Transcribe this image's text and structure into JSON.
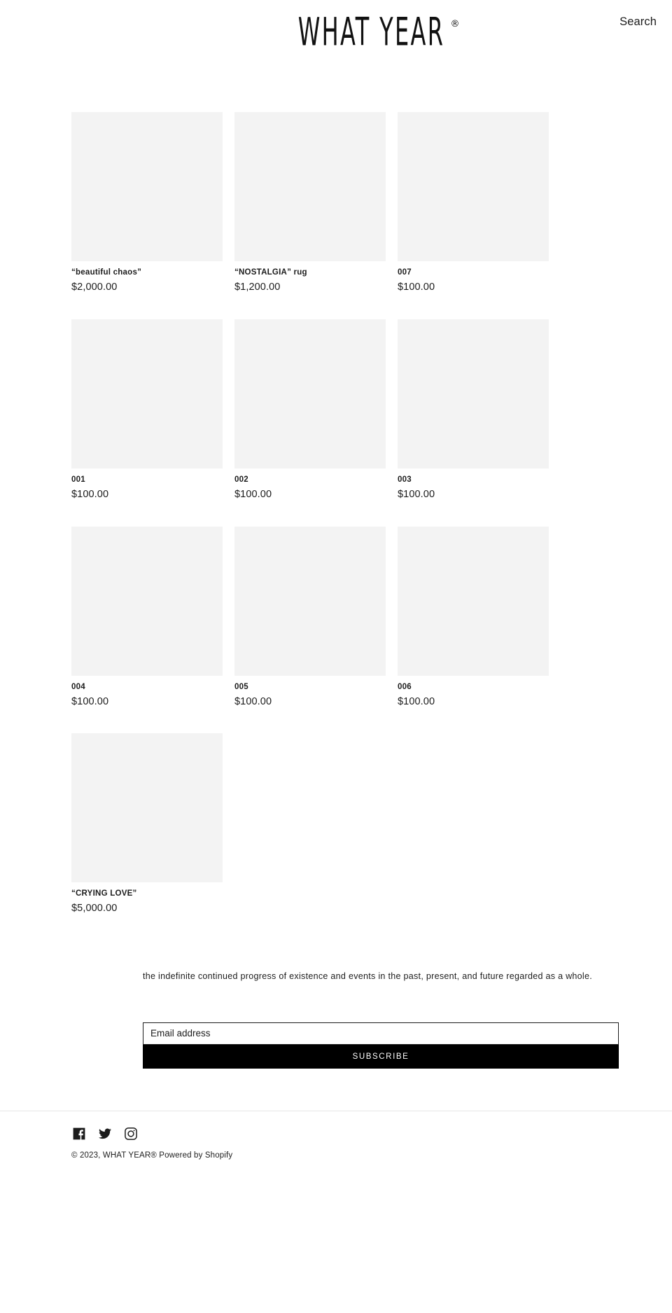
{
  "header": {
    "logo_text": "WHAT YEAR",
    "logo_registered": "®",
    "search_label": "Search"
  },
  "products": [
    {
      "title": "“beautiful chaos”",
      "price": "$2,000.00"
    },
    {
      "title": "“NOSTALGIA” rug",
      "price": "$1,200.00"
    },
    {
      "title": "007",
      "price": "$100.00"
    },
    {
      "title": "001",
      "price": "$100.00"
    },
    {
      "title": "002",
      "price": "$100.00"
    },
    {
      "title": "003",
      "price": "$100.00"
    },
    {
      "title": "004",
      "price": "$100.00"
    },
    {
      "title": "005",
      "price": "$100.00"
    },
    {
      "title": "006",
      "price": "$100.00"
    },
    {
      "title": "“CRYING LOVE”",
      "price": "$5,000.00"
    }
  ],
  "tagline": "the indefinite continued progress of existence and events in the past, present, and future regarded as a whole.",
  "newsletter": {
    "email_placeholder": "Email address",
    "email_value": "",
    "subscribe_label": "SUBSCRIBE"
  },
  "footer": {
    "social": [
      {
        "name": "facebook-icon",
        "label": "Facebook"
      },
      {
        "name": "twitter-icon",
        "label": "Twitter"
      },
      {
        "name": "instagram-icon",
        "label": "Instagram"
      }
    ],
    "copyright_prefix": "© 2023, ",
    "shop_name": "WHAT YEAR®",
    "powered_by": " Powered by Shopify"
  },
  "colors": {
    "background": "#ffffff",
    "text": "#1c1c1c",
    "placeholder_image": "#f3f3f3",
    "button_bg": "#000000",
    "button_text": "#ffffff",
    "rule": "#e6e6e6"
  }
}
